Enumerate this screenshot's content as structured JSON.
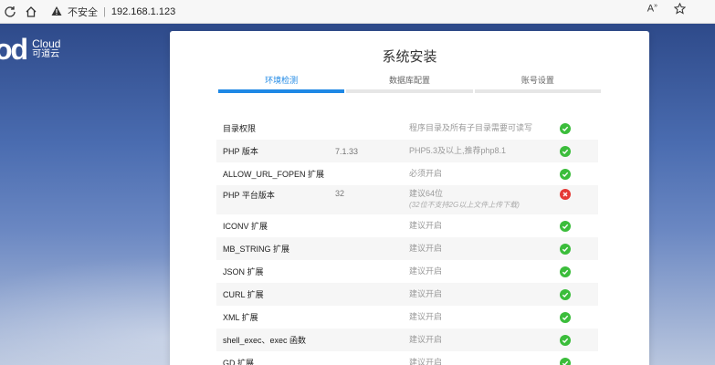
{
  "browser": {
    "security_label": "不安全",
    "url": "192.168.1.123"
  },
  "logo": {
    "mark": "od",
    "en": "Cloud",
    "cn": "可道云"
  },
  "install": {
    "title": "系统安装",
    "tabs": [
      {
        "label": "环境检测",
        "active": true
      },
      {
        "label": "数据库配置",
        "active": false
      },
      {
        "label": "账号设置",
        "active": false
      }
    ],
    "checks": [
      {
        "name": "目录权限",
        "value": "",
        "requirement": "程序目录及所有子目录需要可读写",
        "note": "",
        "status": "ok"
      },
      {
        "name": "PHP 版本",
        "value": "7.1.33",
        "requirement": "PHP5.3及以上,推荐php8.1",
        "note": "",
        "status": "ok"
      },
      {
        "name": "ALLOW_URL_FOPEN 扩展",
        "value": "",
        "requirement": "必须开启",
        "note": "",
        "status": "ok"
      },
      {
        "name": "PHP 平台版本",
        "value": "32",
        "requirement": "建议64位",
        "note": "(32位不支持2G以上文件上传下载)",
        "status": "error"
      },
      {
        "name": "ICONV 扩展",
        "value": "",
        "requirement": "建议开启",
        "note": "",
        "status": "ok"
      },
      {
        "name": "MB_STRING 扩展",
        "value": "",
        "requirement": "建议开启",
        "note": "",
        "status": "ok"
      },
      {
        "name": "JSON 扩展",
        "value": "",
        "requirement": "建议开启",
        "note": "",
        "status": "ok"
      },
      {
        "name": "CURL 扩展",
        "value": "",
        "requirement": "建议开启",
        "note": "",
        "status": "ok"
      },
      {
        "name": "XML 扩展",
        "value": "",
        "requirement": "建议开启",
        "note": "",
        "status": "ok"
      },
      {
        "name": "shell_exec、exec 函数",
        "value": "",
        "requirement": "建议开启",
        "note": "",
        "status": "ok"
      },
      {
        "name": "GD 扩展",
        "value": "",
        "requirement": "建议开启",
        "note": "",
        "status": "ok"
      }
    ]
  },
  "colors": {
    "accent": "#1e88e5",
    "ok": "#3bbd3b",
    "error": "#e53935"
  }
}
